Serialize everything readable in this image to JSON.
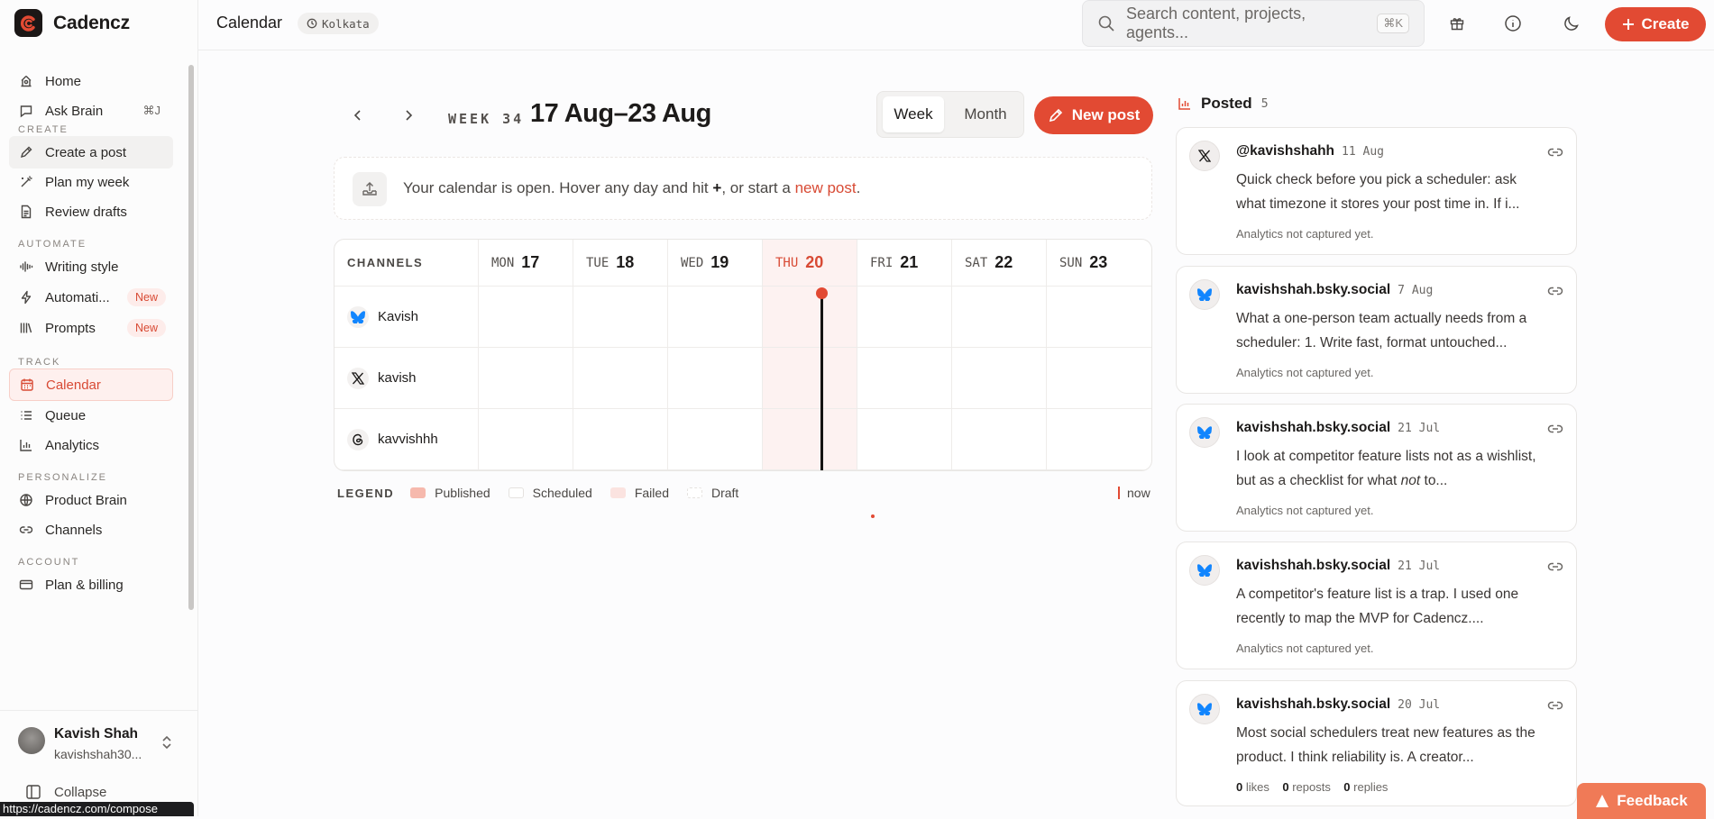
{
  "app": {
    "name": "Cadencz",
    "page_title": "Calendar",
    "timezone": "Kolkata"
  },
  "search": {
    "placeholder": "Search content, projects, agents...",
    "shortcut": "⌘K"
  },
  "topbar": {
    "create_label": "Create"
  },
  "sidebar": {
    "home": "Home",
    "ask_brain": "Ask Brain",
    "ask_brain_kbd": "⌘J",
    "sec_create": "CREATE",
    "create_post": "Create a post",
    "plan_week": "Plan my week",
    "review_drafts": "Review drafts",
    "sec_automate": "AUTOMATE",
    "writing_style": "Writing style",
    "automations": "Automati...",
    "automations_badge": "New",
    "prompts": "Prompts",
    "prompts_badge": "New",
    "sec_track": "TRACK",
    "calendar": "Calendar",
    "queue": "Queue",
    "analytics": "Analytics",
    "sec_personalize": "PERSONALIZE",
    "product_brain": "Product Brain",
    "channels": "Channels",
    "sec_account": "ACCOUNT",
    "plan_billing": "Plan & billing",
    "user_name": "Kavish Shah",
    "user_email": "kavishshah30...",
    "collapse": "Collapse",
    "status_url": "https://cadencz.com/compose"
  },
  "calendar": {
    "week_label": "WEEK 34",
    "range": "17 Aug–23 Aug",
    "view_week": "Week",
    "view_month": "Month",
    "selected_view": "Week",
    "new_post": "New post",
    "banner_pre": "Your calendar is open. Hover any day and hit ",
    "banner_plus": "+",
    "banner_mid": ", or start a ",
    "banner_link": "new post",
    "banner_end": ".",
    "channels_header": "CHANNELS",
    "days": [
      {
        "name": "MON",
        "num": "17"
      },
      {
        "name": "TUE",
        "num": "18"
      },
      {
        "name": "WED",
        "num": "19"
      },
      {
        "name": "THU",
        "num": "20"
      },
      {
        "name": "FRI",
        "num": "21"
      },
      {
        "name": "SAT",
        "num": "22"
      },
      {
        "name": "SUN",
        "num": "23"
      }
    ],
    "channels": [
      {
        "name": "Kavish",
        "network": "bluesky"
      },
      {
        "name": "kavish",
        "network": "x"
      },
      {
        "name": "kavvishhh",
        "network": "threads"
      }
    ],
    "legend_title": "LEGEND",
    "legend": {
      "published": "Published",
      "scheduled": "Scheduled",
      "failed": "Failed",
      "draft": "Draft"
    },
    "now_label": "now"
  },
  "posted": {
    "title": "Posted",
    "count": "5",
    "cards": [
      {
        "handle": "@kavishshahh",
        "date": "11 Aug",
        "network": "x",
        "text": "Quick check before you pick a scheduler: ask what timezone it stores your post time in. If i...",
        "foot": "Analytics not captured yet."
      },
      {
        "handle": "kavishshah.bsky.social",
        "date": "7 Aug",
        "network": "bluesky",
        "text": "What a one-person team actually needs from a scheduler: 1. Write fast, format untouched...",
        "foot": "Analytics not captured yet."
      },
      {
        "handle": "kavishshah.bsky.social",
        "date": "21 Jul",
        "network": "bluesky",
        "text_pre": "I look at competitor feature lists not as a wishlist, but as a checklist for what ",
        "text_em": "not",
        "text_post": " to...",
        "foot": "Analytics not captured yet."
      },
      {
        "handle": "kavishshah.bsky.social",
        "date": "21 Jul",
        "network": "bluesky",
        "text": "A competitor's feature list is a trap. I used one recently to map the MVP for Cadencz....",
        "foot": "Analytics not captured yet."
      },
      {
        "handle": "kavishshah.bsky.social",
        "date": "20 Jul",
        "network": "bluesky",
        "text": "Most social schedulers treat new features as the product. I think reliability is. A creator...",
        "likes": "0",
        "likes_label": "likes",
        "reposts": "0",
        "reposts_label": "reposts",
        "replies": "0",
        "replies_label": "replies"
      }
    ]
  },
  "feedback": "Feedback",
  "colors": {
    "accent": "#e24a33",
    "today_bg": "#fdf2f1",
    "bluesky": "#1185fe"
  }
}
